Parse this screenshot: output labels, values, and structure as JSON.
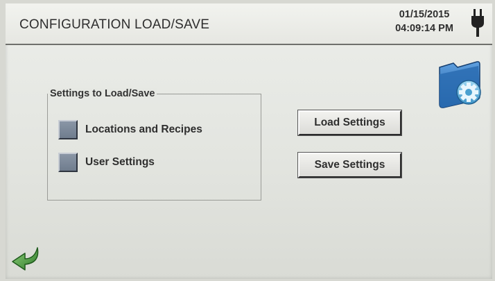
{
  "header": {
    "title": "CONFIGURATION LOAD/SAVE",
    "date": "01/15/2015",
    "time": "04:09:14 PM"
  },
  "settings_group": {
    "title": "Settings to Load/Save",
    "options": [
      {
        "label": "Locations and Recipes",
        "checked": false
      },
      {
        "label": "User Settings",
        "checked": false
      }
    ]
  },
  "buttons": {
    "load": "Load Settings",
    "save": "Save Settings"
  },
  "icons": {
    "power": "plug-icon",
    "config": "folder-gear-icon",
    "back": "back-arrow-icon"
  },
  "colors": {
    "checkbox": "#7b8797",
    "folder": "#2f6fb5",
    "back_arrow": "#3f8a3a"
  }
}
